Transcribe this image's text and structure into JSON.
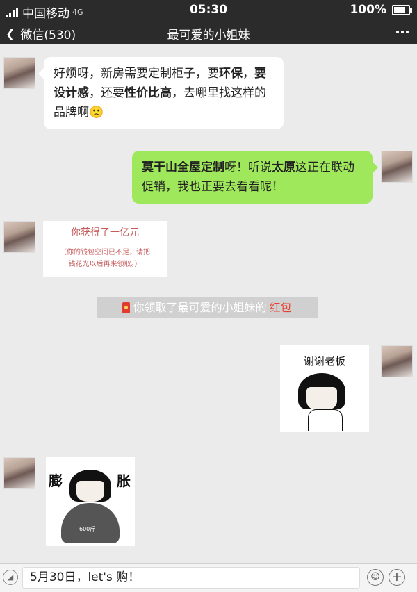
{
  "status": {
    "carrier": "中国移动",
    "network": "4G",
    "time": "05:30",
    "battery": "100%",
    "battery_level": 1.0
  },
  "nav": {
    "back_label": "微信(530)",
    "title": "最可爱的小姐妹"
  },
  "messages": {
    "m1": {
      "t1": "好烦呀，新房需要定制柜子，要",
      "b1": "环保",
      "t2": "，",
      "b2": "要设计感",
      "t3": "，还要",
      "b3": "性价比高",
      "t4": "，去哪里找这样的品牌啊",
      "emoji": "🙁"
    },
    "m2": {
      "b1": "莫干山全屋定制",
      "t1": "呀！听说",
      "b2": "太原",
      "t2": "这正在联动促销，我也正要去看看呢！"
    },
    "card": {
      "title": "你获得了一亿元",
      "line1": "（你的钱包空间已不足，请把",
      "line2": "钱花光以后再来领取。）"
    },
    "system": {
      "text": "你领取了最可爱的小姐妹的",
      "highlight": "红包"
    },
    "sticker_thanks": {
      "caption": "谢谢老板"
    },
    "sticker_swell": {
      "left": "膨",
      "right": "胀",
      "weight": "600斤"
    }
  },
  "input": {
    "text": "5月30日，let's 购！"
  },
  "colors": {
    "green_bubble": "#9fe75b",
    "red_text": "#c65b5b",
    "red_highlight": "#e8402e"
  }
}
